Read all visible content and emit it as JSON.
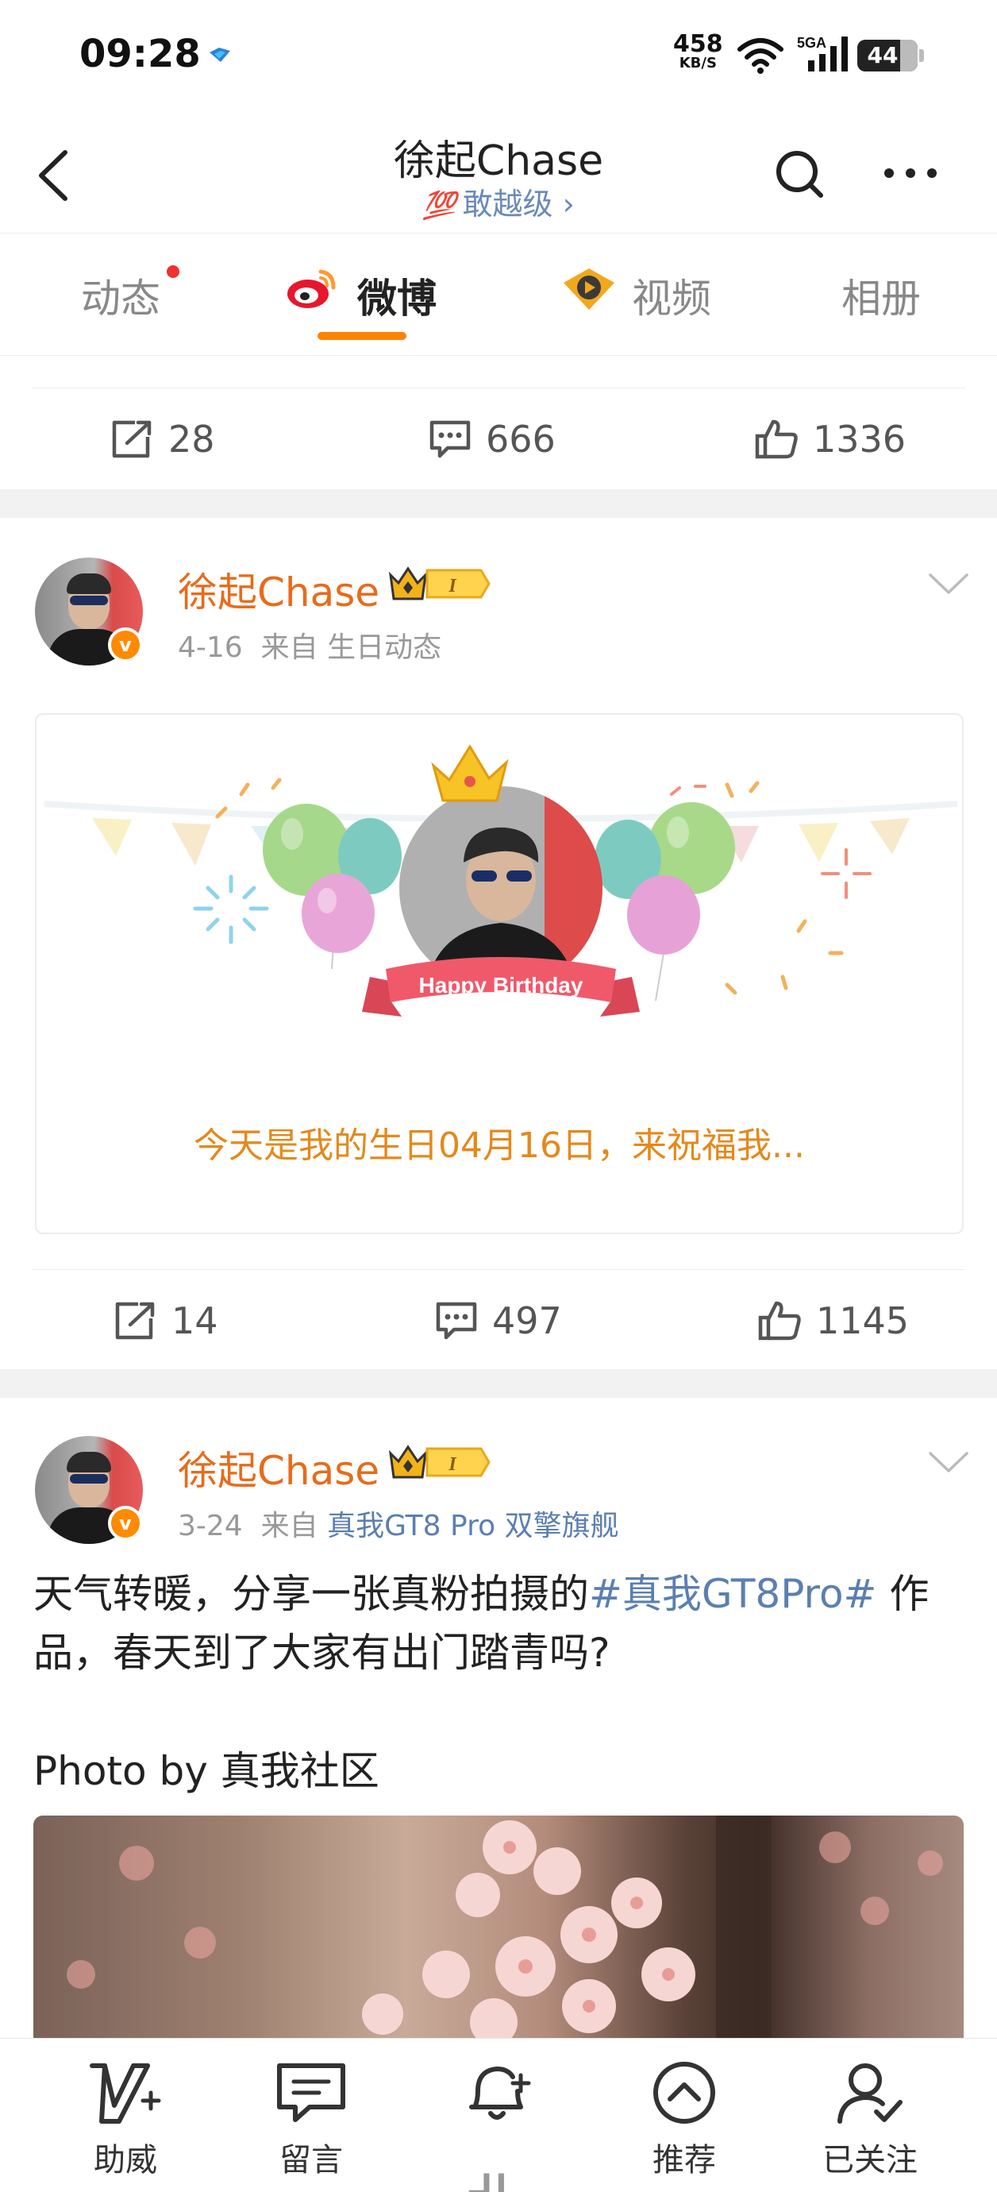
{
  "status_bar": {
    "time": "09:28",
    "net_speed_value": "458",
    "net_speed_unit": "KB/S",
    "network": "5GA",
    "battery": "44"
  },
  "header": {
    "title": "徐起Chase",
    "level_text": "敢越级 ›",
    "level_badge": "💯"
  },
  "tabs": [
    {
      "label": "动态",
      "has_dot": true
    },
    {
      "label": "微博",
      "active": true
    },
    {
      "label": "视频"
    },
    {
      "label": "相册"
    }
  ],
  "post0_actions": {
    "reposts": "28",
    "comments": "666",
    "likes": "1336"
  },
  "post1": {
    "author": "徐起Chase",
    "date": "4-16",
    "from_prefix": "来自",
    "source": "生日动态",
    "card_text": "今天是我的生日04月16日，来祝福我...",
    "banner": "Happy Birthday",
    "actions": {
      "reposts": "14",
      "comments": "497",
      "likes": "1145"
    }
  },
  "post2": {
    "author": "徐起Chase",
    "date": "3-24",
    "from_prefix": "来自",
    "source": "真我GT8 Pro 双擎旗舰",
    "text_before": "天气转暖，分享一张真粉拍摄的",
    "hashtag": "#真我GT8Pro#",
    "text_after": " 作品，春天到了大家有出门踏青吗?",
    "photo_by": "Photo by 真我社区"
  },
  "bottom_bar": [
    {
      "label": "助威",
      "icon": "cheer-icon"
    },
    {
      "label": "留言",
      "icon": "message-icon"
    },
    {
      "label": "",
      "icon": "bell-plus-icon"
    },
    {
      "label": "推荐",
      "icon": "recommend-icon"
    },
    {
      "label": "已关注",
      "icon": "followed-icon"
    }
  ],
  "colors": {
    "accent": "#ff8200",
    "name_orange": "#e86b1a",
    "link_blue": "#5b7fb0",
    "card_text_orange": "#e4891b"
  }
}
